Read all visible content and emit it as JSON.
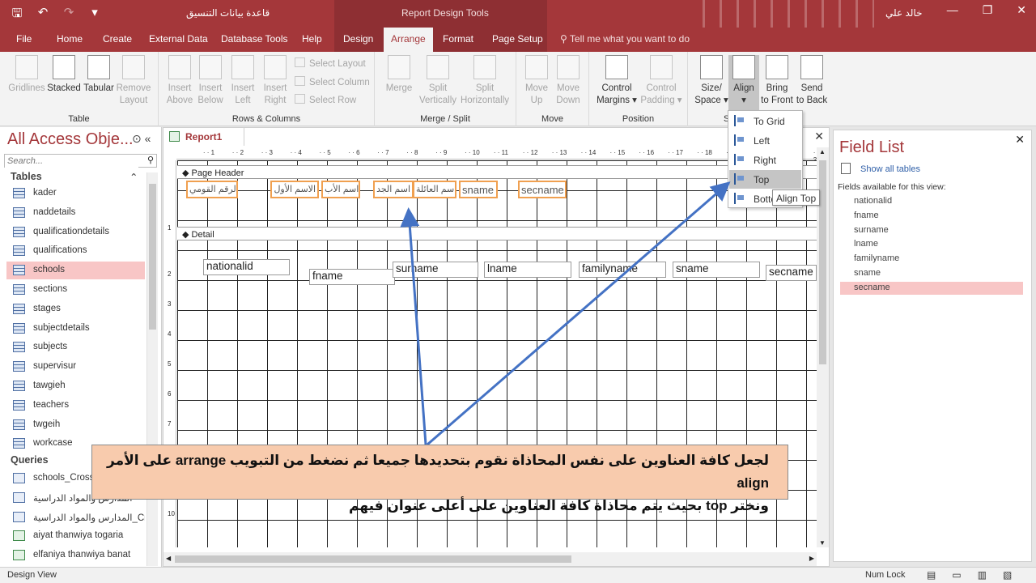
{
  "titlebar": {
    "title": "قاعدة بيانات التنسيق",
    "context_title": "Report Design Tools",
    "user": "خالد علي",
    "qat": {
      "save": "🖫",
      "undo": "↶",
      "redo": "↷",
      "customize": "▾"
    },
    "window_buttons": {
      "minimize": "—",
      "restore": "❐",
      "close": "✕"
    }
  },
  "tabs": {
    "file": "File",
    "home": "Home",
    "create": "Create",
    "external": "External Data",
    "dbtools": "Database Tools",
    "help": "Help",
    "design": "Design",
    "arrange": "Arrange",
    "format": "Format",
    "pagesetup": "Page Setup",
    "tellme": "Tell me what you want to do",
    "tellme_icon": "⚲"
  },
  "ribbon": {
    "table": {
      "label": "Table",
      "gridlines": "Gridlines",
      "stacked": "Stacked",
      "tabular": "Tabular",
      "remove": "Remove",
      "layout": "Layout"
    },
    "rows": {
      "label": "Rows & Columns",
      "insert": "Insert",
      "above": "Above",
      "below": "Below",
      "left": "Left",
      "right": "Right",
      "select_layout": "Select Layout",
      "select_column": "Select Column",
      "select_row": "Select Row"
    },
    "merge": {
      "label": "Merge / Split",
      "merge": "Merge",
      "split": "Split",
      "vertically": "Vertically",
      "horizontally": "Horizontally"
    },
    "move": {
      "label": "Move",
      "move": "Move",
      "up": "Up",
      "down": "Down"
    },
    "position": {
      "label": "Position",
      "control": "Control",
      "margins": "Margins ▾",
      "padding": "Padding ▾"
    },
    "sizing": {
      "size": "Size/",
      "space": "Space ▾",
      "align": "Align",
      "align_caret": "▾",
      "bring": "Bring",
      "to_front": "to Front",
      "send": "Send",
      "to_back": "to Back",
      "label": "S"
    }
  },
  "nav": {
    "title": "All Access Obje...",
    "ctrl_menu": "⊙",
    "ctrl_collapse": "«",
    "search_placeholder": "Search...",
    "search_icon": "⚲",
    "tables_header": "Tables",
    "tables_chevron": "⌃",
    "tables": [
      "kader",
      "naddetails",
      "qualificationdetails",
      "qualifications",
      "schools",
      "sections",
      "stages",
      "subjectdetails",
      "subjects",
      "supervisur",
      "tawgieh",
      "teachers",
      "twgeih",
      "workcase"
    ],
    "selected": "schools",
    "queries_header": "Queries",
    "queries": [
      "schools_Crosst...",
      "المدارس والمواد الدراسية",
      "المدارس والمواد الدراسية_Crosst...",
      "aiyat thanwiya togaria",
      "elfaniya thanwiya banat"
    ]
  },
  "document": {
    "tab": "Report1",
    "close": "✕",
    "page_header": "Page Header",
    "detail": "Detail",
    "header_labels": [
      "الرقم القومي",
      "الاسم الأول",
      "اسم الأب",
      "اسم الجد",
      "اسم العائلة",
      "sname",
      "secname"
    ],
    "fields": [
      "nationalid",
      "fname",
      "surname",
      "lname",
      "familyname",
      "sname",
      "secname"
    ],
    "section_marker": "◆",
    "scroll_up": "▲",
    "scroll_down": "▼",
    "scroll_left": "◀",
    "scroll_right": "▶"
  },
  "align_menu": {
    "items": [
      "To Grid",
      "Left",
      "Right",
      "Top",
      "Bottom"
    ],
    "highlighted": "Top",
    "tooltip": "Align Top"
  },
  "fieldlist": {
    "title": "Field List",
    "close": "✕",
    "show_all": "Show all tables",
    "available": "Fields available for this view:",
    "fields": [
      "nationalid",
      "fname",
      "surname",
      "lname",
      "familyname",
      "sname",
      "secname"
    ],
    "selected": "secname"
  },
  "annotation": {
    "line1": "لجعل كافة العناوين على نفس المحاذاة نقوم بتحديدها جميعا ثم نضغط من التبويب arrange على الأمر align",
    "line2": "ونختر top بحيث يتم محاذاة كافة العناوين على أعلى عنوان فيهم",
    "arrow_color": "#4472c4"
  },
  "status": {
    "left": "Design View",
    "numlock": "Num Lock",
    "view_icons": [
      "▤",
      "▭",
      "▥",
      "▧"
    ]
  },
  "colors": {
    "accent": "#a4373a",
    "context": "#8e2f33",
    "selection": "#f8c6c6",
    "callout": "#f8cbad"
  }
}
